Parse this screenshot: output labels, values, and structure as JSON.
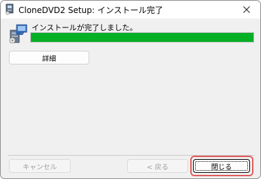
{
  "window": {
    "title": "CloneDVD2 Setup: インストール完了",
    "title_icon": "installer-icon",
    "close_icon": "close-icon"
  },
  "main": {
    "icon": "setup-computer-icon",
    "status_text": "インストールが完了しました。",
    "progress_percent": 100,
    "progress_color": "#06b025",
    "details_button": "詳細"
  },
  "footer": {
    "cancel_button": "キャンセル",
    "back_button": "< 戻る",
    "close_button": "閉じる",
    "highlight_color": "#e05a5a"
  }
}
